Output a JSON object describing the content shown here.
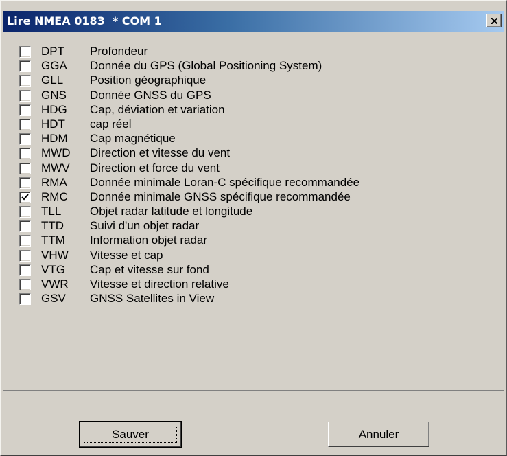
{
  "window": {
    "title": "Lire NMEA 0183  * COM 1"
  },
  "sentences": [
    {
      "code": "DPT",
      "label": "Profondeur",
      "checked": false
    },
    {
      "code": "GGA",
      "label": "Donnée du GPS (Global Positioning System)",
      "checked": false
    },
    {
      "code": "GLL",
      "label": "Position géographique",
      "checked": false
    },
    {
      "code": "GNS",
      "label": "Donnée GNSS du GPS",
      "checked": false
    },
    {
      "code": "HDG",
      "label": "Cap, déviation et variation",
      "checked": false
    },
    {
      "code": "HDT",
      "label": "cap réel",
      "checked": false
    },
    {
      "code": "HDM",
      "label": "Cap magnétique",
      "checked": false
    },
    {
      "code": "MWD",
      "label": "Direction et vitesse du vent",
      "checked": false
    },
    {
      "code": "MWV",
      "label": "Direction et force du vent",
      "checked": false
    },
    {
      "code": "RMA",
      "label": "Donnée minimale Loran-C spécifique recommandée",
      "checked": false
    },
    {
      "code": "RMC",
      "label": "Donnée minimale GNSS spécifique recommandée",
      "checked": true
    },
    {
      "code": "TLL",
      "label": "Objet radar latitude et longitude",
      "checked": false
    },
    {
      "code": "TTD",
      "label": "Suivi d'un objet radar",
      "checked": false
    },
    {
      "code": "TTM",
      "label": "Information objet radar",
      "checked": false
    },
    {
      "code": "VHW",
      "label": "Vitesse et cap",
      "checked": false
    },
    {
      "code": "VTG",
      "label": "Cap et vitesse sur fond",
      "checked": false
    },
    {
      "code": "VWR",
      "label": "Vitesse et direction relative",
      "checked": false
    },
    {
      "code": "GSV",
      "label": "GNSS Satellites in View",
      "checked": false
    }
  ],
  "buttons": {
    "save_label": "Sauver",
    "cancel_label": "Annuler"
  },
  "icons": {
    "close": "close-icon",
    "check": "checkmark-icon"
  },
  "colors": {
    "title_start": "#0a246a",
    "title_end": "#a6caf0",
    "face": "#d4d0c8"
  }
}
